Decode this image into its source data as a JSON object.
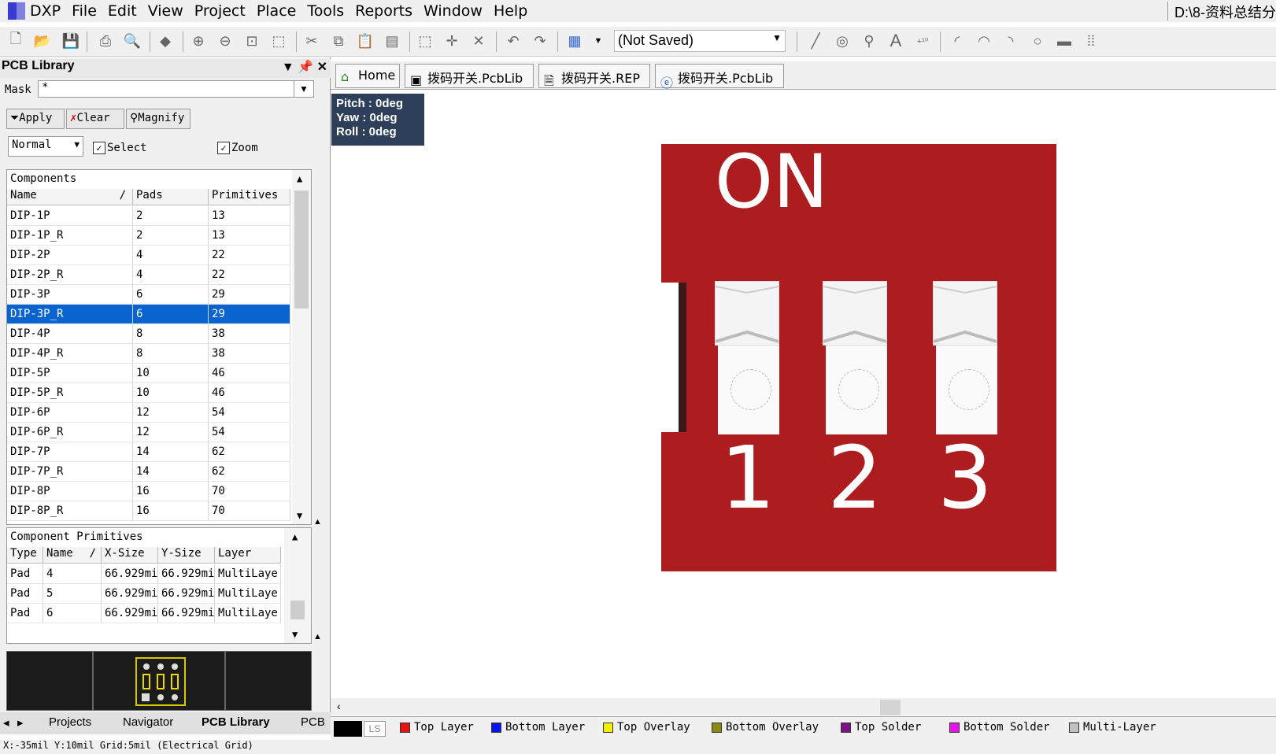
{
  "menubar": {
    "items": [
      "DXP",
      "File",
      "Edit",
      "View",
      "Project",
      "Place",
      "Tools",
      "Reports",
      "Window",
      "Help"
    ],
    "path": "D:\\8-资料总结分"
  },
  "toolbar": {
    "snapshot_select": "(Not Saved)"
  },
  "panel": {
    "title": "PCB Library",
    "mask_label": "Mask",
    "mask_value": "*",
    "apply_label": "Apply",
    "clear_label": "Clear",
    "magnify_label": "Magnify",
    "mode_value": "Normal",
    "select_label": "Select",
    "zoom_label": "Zoom",
    "components": {
      "title": "Components",
      "columns": [
        "Name",
        "Pads",
        "Primitives"
      ],
      "rows": [
        [
          "DIP-1P",
          "2",
          "13"
        ],
        [
          "DIP-1P_R",
          "2",
          "13"
        ],
        [
          "DIP-2P",
          "4",
          "22"
        ],
        [
          "DIP-2P_R",
          "4",
          "22"
        ],
        [
          "DIP-3P",
          "6",
          "29"
        ],
        [
          "DIP-3P_R",
          "6",
          "29"
        ],
        [
          "DIP-4P",
          "8",
          "38"
        ],
        [
          "DIP-4P_R",
          "8",
          "38"
        ],
        [
          "DIP-5P",
          "10",
          "46"
        ],
        [
          "DIP-5P_R",
          "10",
          "46"
        ],
        [
          "DIP-6P",
          "12",
          "54"
        ],
        [
          "DIP-6P_R",
          "12",
          "54"
        ],
        [
          "DIP-7P",
          "14",
          "62"
        ],
        [
          "DIP-7P_R",
          "14",
          "62"
        ],
        [
          "DIP-8P",
          "16",
          "70"
        ],
        [
          "DIP-8P_R",
          "16",
          "70"
        ]
      ],
      "selected_index": 5
    },
    "primitives": {
      "title": "Component Primitives",
      "columns": [
        "Type",
        "Name",
        "X-Size",
        "Y-Size",
        "Layer"
      ],
      "rows": [
        [
          "Pad",
          "4",
          "66.929mi",
          "66.929mi",
          "MultiLaye"
        ],
        [
          "Pad",
          "5",
          "66.929mi",
          "66.929mi",
          "MultiLaye"
        ],
        [
          "Pad",
          "6",
          "66.929mi",
          "66.929mi",
          "MultiLaye"
        ]
      ]
    },
    "bottom_tabs": [
      "Projects",
      "Navigator",
      "PCB Library",
      "PCB"
    ]
  },
  "doc_tabs": [
    "Home",
    "拨码开关.PcbLib",
    "拨码开关.REP",
    "拨码开关.PcbLib"
  ],
  "hud": {
    "pitch": "Pitch : 0deg",
    "yaw": "Yaw : 0deg",
    "roll": "Roll : 0deg"
  },
  "board": {
    "label": "ON",
    "switch_numbers": [
      "1",
      "2",
      "3"
    ],
    "color": "#ad1c1e"
  },
  "layers": {
    "ls_label": "LS",
    "items": [
      {
        "name": "Top Layer",
        "color": "#e81414"
      },
      {
        "name": "Bottom Layer",
        "color": "#0a14e8"
      },
      {
        "name": "Top Overlay",
        "color": "#f0f000"
      },
      {
        "name": "Bottom Overlay",
        "color": "#8a8a14"
      },
      {
        "name": "Top Solder",
        "color": "#7a1486"
      },
      {
        "name": "Bottom Solder",
        "color": "#e814e8"
      },
      {
        "name": "Multi-Layer",
        "color": "#c0c0c0"
      }
    ]
  },
  "status": {
    "text": "X:-35mil Y:10mil    Grid:5mil    (Electrical Grid)"
  }
}
